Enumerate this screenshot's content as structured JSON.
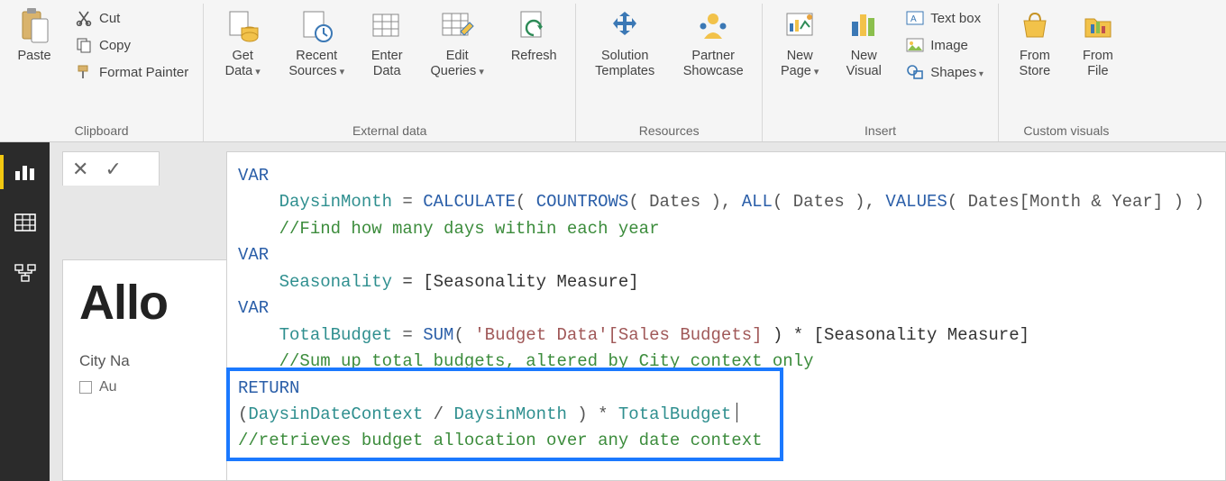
{
  "ribbon": {
    "clipboard": {
      "title": "Clipboard",
      "paste": "Paste",
      "cut": "Cut",
      "copy": "Copy",
      "format_painter": "Format Painter"
    },
    "external_data": {
      "title": "External data",
      "get_data_l1": "Get",
      "get_data_l2": "Data",
      "recent_l1": "Recent",
      "recent_l2": "Sources",
      "enter_l1": "Enter",
      "enter_l2": "Data",
      "edit_l1": "Edit",
      "edit_l2": "Queries",
      "refresh": "Refresh"
    },
    "resources": {
      "title": "Resources",
      "solution_l1": "Solution",
      "solution_l2": "Templates",
      "partner_l1": "Partner",
      "partner_l2": "Showcase"
    },
    "insert": {
      "title": "Insert",
      "newpage_l1": "New",
      "newpage_l2": "Page",
      "newvisual_l1": "New",
      "newvisual_l2": "Visual",
      "textbox": "Text box",
      "image": "Image",
      "shapes": "Shapes"
    },
    "custom_visuals": {
      "title": "Custom visuals",
      "from_store_l1": "From",
      "from_store_l2": "Store",
      "from_file_l1": "From",
      "from_file_l2": "File"
    }
  },
  "page": {
    "title_cut": "Allo",
    "slicer_label": "City Na",
    "slicer_item1": "Au"
  },
  "dax": {
    "l1": "VAR",
    "l2a": "    DaysinMonth",
    "l2b": " = ",
    "l2c": "CALCULATE",
    "l2d": "( ",
    "l2e": "COUNTROWS",
    "l2f": "( Dates ), ",
    "l2g": "ALL",
    "l2h": "( Dates ), ",
    "l2i": "VALUES",
    "l2j": "( Dates[Month & Year] ) )",
    "l3": "    //Find how many days within each year",
    "l4": "VAR",
    "l5a": "    Seasonality",
    "l5b": " = [Seasonality Measure]",
    "l6": "VAR",
    "l7a": "    TotalBudget",
    "l7b": " = ",
    "l7c": "SUM",
    "l7d": "( ",
    "l7e": "'Budget Data'[Sales Budgets]",
    "l7f": " ) * [Seasonality Measure]",
    "l8": "    //Sum up total budgets, altered by City context only",
    "l9": "RETURN",
    "l10a": "(",
    "l10b": "DaysinDateContext",
    "l10c": " / ",
    "l10d": "DaysinMonth",
    "l10e": " ) * ",
    "l10f": "TotalBudget",
    "l11": "//retrieves budget allocation over any date context"
  }
}
